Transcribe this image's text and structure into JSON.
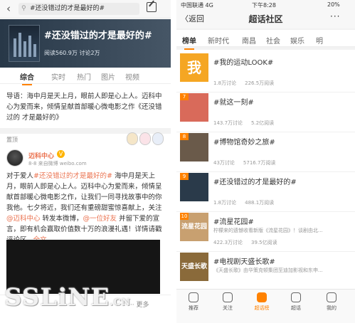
{
  "left": {
    "search": {
      "query": "#还没错过的才是最好的#"
    },
    "banner": {
      "title": "#还没错过的才是最好的#",
      "stats": "阅读560.9万  讨论2万"
    },
    "tabs": [
      "综合",
      "实时",
      "热门",
      "图片",
      "视频"
    ],
    "guide": "导语：海中月是天上月，眼前人即是心上人。迈科中心为爱而来，倾情呈献首部暖心微电影之作《还没错过的 才是最好的》",
    "pinned_label": "置顶",
    "post": {
      "user": "迈科中心",
      "vip": "V",
      "meta": "8-8  来自微博 weibo.com",
      "text_a": "对于爱人",
      "link_a": "#还没错过的才是最好的#",
      "text_b": " 海中月是天上月，眼前人即是心上人。迈科中心为爱而来，倾情呈献首部暖心微电影之作，让我们一同寻找故事中的你我他。七夕将近，我们还有重磅甜蜜惊喜献上，关注",
      "link_b": "@迈科中心",
      "text_c": " 转发本微博，",
      "link_c": "@一位好友",
      "text_d": " 并留下爱的宣言，即有机会赢取价值数十万的浪漫礼遇！详情请戳评论区...",
      "link_d": "全文"
    },
    "more": "··· 更多"
  },
  "right": {
    "status": {
      "carrier": "中国联通  4G",
      "time": "下午8:28",
      "battery": "20%"
    },
    "nav": {
      "back": "〈返回",
      "title": "超话社区",
      "menu": "···"
    },
    "tabs": [
      "榜单",
      "新时代",
      "南昌",
      "社会",
      "娱乐",
      "明"
    ],
    "items": [
      {
        "rank": "",
        "img_text": "我",
        "name": "#我的运动LOOK#",
        "desc": "",
        "discuss": "1.8万讨论",
        "read": "226.5万阅读",
        "color": "#f5a623"
      },
      {
        "rank": "7",
        "img_text": "",
        "name": "#就这一刻#",
        "desc": "",
        "discuss": "143.7万讨论",
        "read": "5.2亿阅读",
        "color": "#d96a5a"
      },
      {
        "rank": "8",
        "img_text": "",
        "name": "#博物馆奇妙之旅#",
        "desc": "",
        "discuss": "43万讨论",
        "read": "5716.7万阅读",
        "color": "#6a5a4a"
      },
      {
        "rank": "9",
        "img_text": "",
        "name": "#还没错过的才是最好的#",
        "desc": "",
        "discuss": "1.8万讨论",
        "read": "488.1万阅读",
        "color": "#2a3a4a"
      },
      {
        "rank": "10",
        "img_text": "流星花园",
        "name": "#流星花园#",
        "desc": "柠檬来的遗憾收看新版《流星花园》！谈剧由北...",
        "discuss": "422.3万讨论",
        "read": "39.5亿阅读",
        "color": "#c8a070"
      },
      {
        "rank": "",
        "img_text": "天盛长歌",
        "name": "#电视剧天盛长歌#",
        "desc": "《天盛长歌》由华策克顿集团至迪加影视和东申...",
        "discuss": "",
        "read": "",
        "color": "#8a6a3a"
      }
    ],
    "bottom": [
      "推荐",
      "关注",
      "超话榜",
      "超话",
      "我的"
    ]
  },
  "watermark": {
    "main": "SSLiNE",
    "suffix": ".CN"
  }
}
